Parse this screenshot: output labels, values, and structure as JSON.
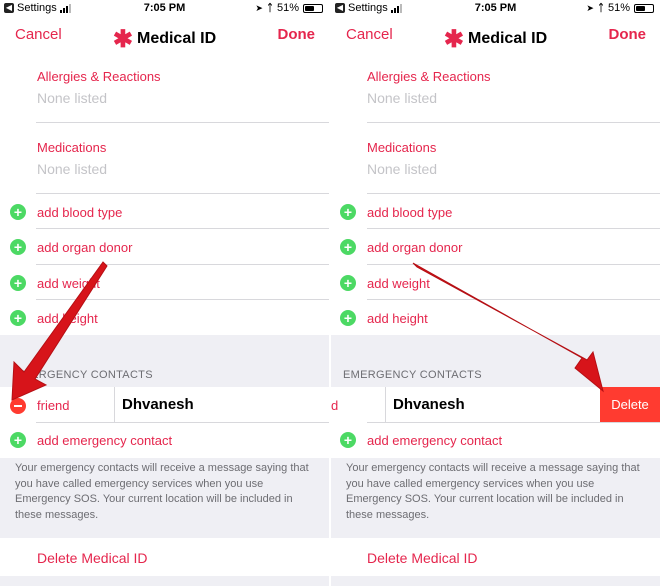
{
  "screens": [
    {
      "status": {
        "carrier": "Settings",
        "time": "7:05 PM",
        "battery": "51%"
      },
      "nav": {
        "cancel": "Cancel",
        "title": "Medical ID",
        "done": "Done"
      },
      "fields": [
        {
          "label": "Allergies & Reactions",
          "value": "None listed"
        },
        {
          "label": "Medications",
          "value": "None listed"
        }
      ],
      "add_items": [
        "add blood type",
        "add organ donor",
        "add weight",
        "add height"
      ],
      "emergency_header": "EMERGENCY CONTACTS",
      "contact": {
        "relation": "friend",
        "name": "Dhvanesh"
      },
      "add_contact": "add emergency contact",
      "note": "Your emergency contacts will receive a message saying that you have called emergency services when you use Emergency SOS. Your current location will be included in these messages.",
      "delete_medical": "Delete Medical ID"
    },
    {
      "status": {
        "carrier": "Settings",
        "time": "7:05 PM",
        "battery": "51%"
      },
      "nav": {
        "cancel": "Cancel",
        "title": "Medical ID",
        "done": "Done"
      },
      "fields": [
        {
          "label": "Allergies & Reactions",
          "value": "None listed"
        },
        {
          "label": "Medications",
          "value": "None listed"
        }
      ],
      "add_items": [
        "add blood type",
        "add organ donor",
        "add weight",
        "add height"
      ],
      "emergency_header": "EMERGENCY CONTACTS",
      "contact": {
        "relation": "d",
        "name": "Dhvanesh"
      },
      "delete_button": "Delete",
      "add_contact": "add emergency contact",
      "note": "Your emergency contacts will receive a message saying that you have called emergency services when you use Emergency SOS. Your current location will be included in these messages.",
      "delete_medical": "Delete Medical ID"
    }
  ],
  "colors": {
    "accent": "#e5264d",
    "add_green": "#4cd964",
    "delete_red": "#ff3b30",
    "arrow_red": "#d7141a"
  },
  "icons": [
    "back-icon",
    "signal-icon",
    "location-icon",
    "bluetooth-icon",
    "battery-icon",
    "asterisk-icon",
    "add-icon",
    "minus-icon",
    "arrow-icon"
  ]
}
